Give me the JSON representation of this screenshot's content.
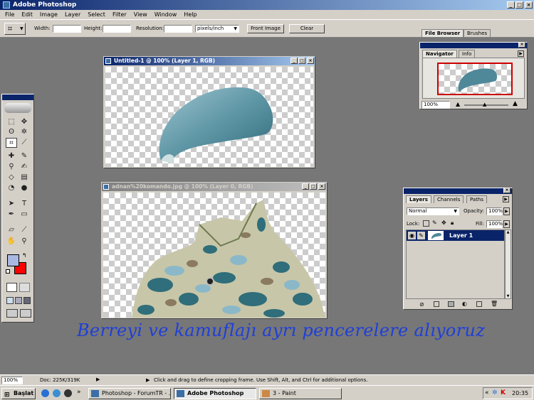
{
  "app": {
    "title": "Adobe Photoshop"
  },
  "menu": [
    "File",
    "Edit",
    "Image",
    "Layer",
    "Select",
    "Filter",
    "View",
    "Window",
    "Help"
  ],
  "options": {
    "width_label": "Width:",
    "height_label": "Height:",
    "resolution_label": "Resolution:",
    "units_value": "pixels/inch",
    "front_image": "Front Image",
    "clear": "Clear",
    "tab_file_browser": "File Browser",
    "tab_brushes": "Brushes"
  },
  "doc1": {
    "title": "Untitled-1 @ 100% (Layer 1, RGB)"
  },
  "doc2": {
    "title": "adnan%20komando.jpg @ 100% (Layer 0, RGB)"
  },
  "navigator": {
    "tab_nav": "Navigator",
    "tab_info": "Info",
    "zoom": "100%"
  },
  "layers": {
    "tab_layers": "Layers",
    "tab_channels": "Channels",
    "tab_paths": "Paths",
    "blend_mode": "Normal",
    "opacity_label": "Opacity:",
    "opacity_value": "100%",
    "lock_label": "Lock:",
    "fill_label": "Fill:",
    "fill_value": "100%",
    "layer_name": "Layer 1"
  },
  "status": {
    "zoom": "100%",
    "doc_size": "Doc: 225K/319K",
    "hint": "Click and drag to define cropping frame. Use Shift, Alt, and Ctrl for additional options."
  },
  "caption": "Berreyi ve kamuflajı ayrı pencerelere alıyoruz",
  "taskbar": {
    "start": "Başlat",
    "task1": "Photoshop - ForumTR - ...",
    "task2": "Adobe Photoshop",
    "task3": "3 - Paint",
    "clock": "20:35"
  },
  "colors": {
    "foreground": "#a8b8e0",
    "background": "#ff0000",
    "accent": "#0a246a"
  }
}
